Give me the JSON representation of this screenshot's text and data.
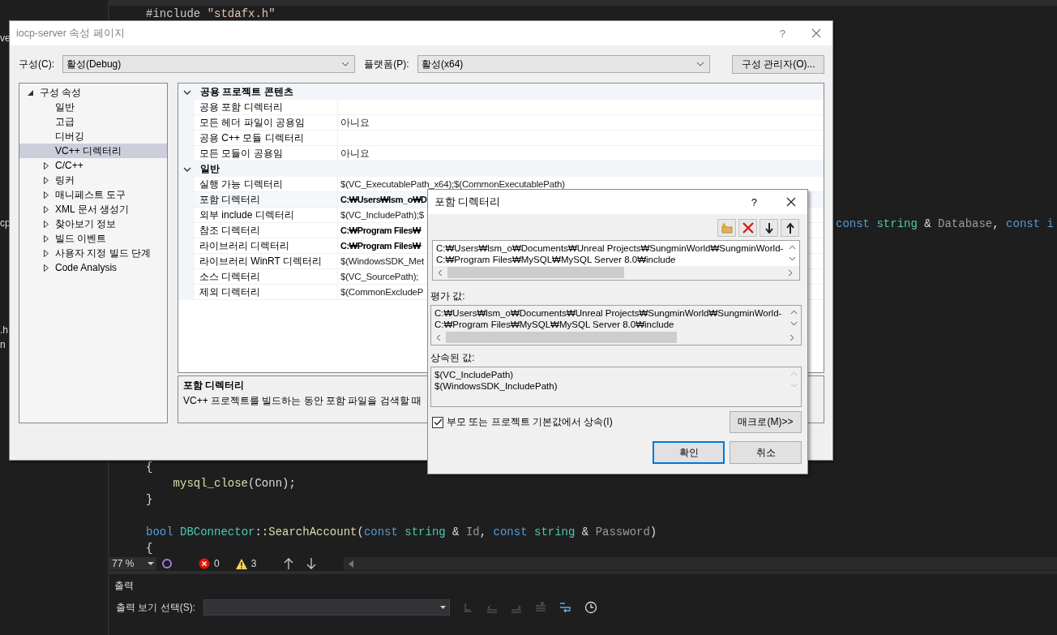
{
  "ide": {
    "left_fragments": [
      "ve",
      "cp",
      ".h",
      "n"
    ],
    "code_blocks": [
      [
        [
          {
            "text": "#include ",
            "kind": "preproc"
          },
          {
            "text": "\"stdafx.h\"",
            "kind": "string"
          }
        ]
      ],
      [
        [
          {
            "text": "const ",
            "kind": "keyword"
          },
          {
            "text": "string",
            "kind": "type"
          },
          {
            "text": " & ",
            "kind": "plain"
          },
          {
            "text": "Database",
            "kind": "param"
          },
          {
            "text": ", ",
            "kind": "plain"
          },
          {
            "text": "const i",
            "kind": "keyword"
          }
        ]
      ],
      [
        [
          {
            "text": "{",
            "kind": "plain"
          }
        ],
        [
          {
            "text": "    mysql_close",
            "kind": "func"
          },
          {
            "text": "(Conn);",
            "kind": "plain"
          }
        ],
        [
          {
            "text": "}",
            "kind": "plain"
          }
        ]
      ],
      [
        [
          {
            "text": "bool ",
            "kind": "keyword"
          },
          {
            "text": "DBConnector",
            "kind": "type"
          },
          {
            "text": "::",
            "kind": "plain"
          },
          {
            "text": "SearchAccount",
            "kind": "func"
          },
          {
            "text": "(",
            "kind": "plain"
          },
          {
            "text": "const ",
            "kind": "keyword"
          },
          {
            "text": "string",
            "kind": "type"
          },
          {
            "text": " & ",
            "kind": "plain"
          },
          {
            "text": "Id",
            "kind": "param"
          },
          {
            "text": ", ",
            "kind": "plain"
          },
          {
            "text": "const ",
            "kind": "keyword"
          },
          {
            "text": "string",
            "kind": "type"
          },
          {
            "text": " & ",
            "kind": "plain"
          },
          {
            "text": "Password",
            "kind": "param"
          },
          {
            "text": ")",
            "kind": "plain"
          }
        ],
        [
          {
            "text": "{",
            "kind": "plain"
          }
        ]
      ]
    ],
    "status_bar": {
      "zoom": "77 %",
      "errors": "0",
      "warnings": "3"
    },
    "output_panel": {
      "title": "출력",
      "source_label": "출력 보기 선택(S):"
    }
  },
  "property_dialog": {
    "title": "iocp-server 속성 페이지",
    "help": "?",
    "configuration_label": "구성(C):",
    "configuration": "활성(Debug)",
    "platform_label": "플랫폼(P):",
    "platform": "활성(x64)",
    "manager_button": "구성 관리자(O)...",
    "tree": [
      {
        "label": "구성 속성",
        "expanded": true,
        "selected": false,
        "children": [
          {
            "label": "일반",
            "selected": false
          },
          {
            "label": "고급",
            "selected": false
          },
          {
            "label": "디버깅",
            "selected": false
          },
          {
            "label": "VC++ 디렉터리",
            "selected": true
          },
          {
            "label": "C/C++",
            "expanded": false,
            "selected": false
          },
          {
            "label": "링커",
            "expanded": false,
            "selected": false
          },
          {
            "label": "매니페스트 도구",
            "expanded": false,
            "selected": false
          },
          {
            "label": "XML 문서 생성기",
            "expanded": false,
            "selected": false
          },
          {
            "label": "찾아보기 정보",
            "expanded": false,
            "selected": false
          },
          {
            "label": "빌드 이벤트",
            "expanded": false,
            "selected": false
          },
          {
            "label": "사용자 지정 빌드 단계",
            "expanded": false,
            "selected": false
          },
          {
            "label": "Code Analysis",
            "expanded": false,
            "selected": false
          }
        ]
      }
    ],
    "categories": [
      {
        "name": "공용 프로젝트 콘텐츠",
        "expanded": true,
        "rows": [
          {
            "name": "공용 포함 디렉터리",
            "selected": false
          },
          {
            "name": "모든 헤더 파일이 공용임",
            "value": "아니요",
            "selected": false,
            "bold": false
          },
          {
            "name": "공용 C++ 모듈 디렉터리",
            "selected": false
          },
          {
            "name": "모든 모듈이 공용임",
            "value": "아니요",
            "selected": false,
            "bold": false
          }
        ]
      },
      {
        "name": "일반",
        "expanded": true,
        "rows": [
          {
            "name": "실행 가능 디렉터리",
            "value": "$(VC_ExecutablePath_x64);$(CommonExecutablePath)",
            "selected": false,
            "bold": false
          },
          {
            "name": "포함 디렉터리",
            "value": "C:₩Users₩lsm_o₩D",
            "selected": true,
            "bold": true
          },
          {
            "name": "외부 include 디렉터리",
            "value": "$(VC_IncludePath);$",
            "selected": false,
            "bold": false
          },
          {
            "name": "참조 디렉터리",
            "value": "C:₩Program Files₩",
            "selected": false,
            "bold": true
          },
          {
            "name": "라이브러리 디렉터리",
            "value": "C:₩Program Files₩",
            "selected": false,
            "bold": true
          },
          {
            "name": "라이브러리 WinRT 디렉터리",
            "value": "$(WindowsSDK_Met",
            "selected": false,
            "bold": false
          },
          {
            "name": "소스 디렉터리",
            "value": "$(VC_SourcePath);",
            "selected": false,
            "bold": false
          },
          {
            "name": "제외 디렉터리",
            "value": "$(CommonExcludeP",
            "selected": false,
            "bold": false
          }
        ]
      }
    ],
    "description": {
      "title": "포함 디렉터리",
      "text": "VC++ 프로젝트를 빌드하는 동안 포함 파일을 검색할 때"
    }
  },
  "include_dialog": {
    "title": "포함 디렉터리",
    "help": "?",
    "entries": [
      "C:₩Users₩lsm_o₩Documents₩Unreal Projects₩SungminWorld₩SungminWorld-",
      "C:₩Program Files₩MySQL₩MySQL Server 8.0₩include"
    ],
    "evaluated_label": "평가 값:",
    "evaluated": [
      "C:₩Users₩lsm_o₩Documents₩Unreal Projects₩SungminWorld₩SungminWorld-",
      "C:₩Program Files₩MySQL₩MySQL Server 8.0₩include"
    ],
    "inherited_label": "상속된 값:",
    "inherited": [
      "$(VC_IncludePath)",
      "$(WindowsSDK_IncludePath)"
    ],
    "inherit": {
      "label": "부모 또는 프로젝트 기본값에서 상속(I)",
      "checked": true
    },
    "buttons": [
      {
        "kind": "macro",
        "label": "매크로(M)>>",
        "focused": false
      },
      {
        "kind": "ok",
        "label": "확인",
        "focused": true
      },
      {
        "kind": "cancel",
        "label": "취소",
        "focused": false
      }
    ]
  }
}
